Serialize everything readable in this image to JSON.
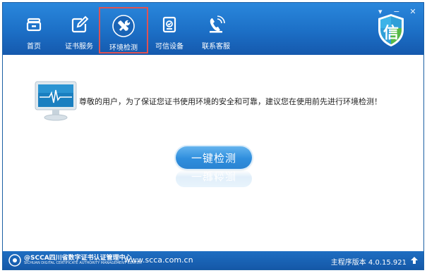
{
  "nav": {
    "items": [
      {
        "label": "首页",
        "icon": "home-icon"
      },
      {
        "label": "证书服务",
        "icon": "edit-icon"
      },
      {
        "label": "环境检测",
        "icon": "tools-icon",
        "active": true
      },
      {
        "label": "可信设备",
        "icon": "device-icon"
      },
      {
        "label": "联系客服",
        "icon": "phone-icon"
      }
    ]
  },
  "window_controls": {
    "dropdown": "▾",
    "minimize": "−",
    "close": "✕"
  },
  "logo": {
    "text": "信",
    "icon": "trust-shield-logo"
  },
  "main": {
    "message": "尊敬的用户，为了保证您证书使用环境的安全和可靠，建议您在使用前先进行环境检测！",
    "check_button": "一键检测",
    "monitor_icon": "monitor-heartbeat-icon"
  },
  "footer": {
    "org_name": "@SCCA四川省数字证书认证管理中心",
    "org_subtitle": "SICHUAN DIGITAL CERTIFICATE AUTHORITY MANAGEMENT CENTER",
    "website": "www.scca.com.cn",
    "version": "主程序版本 4.0.15.921"
  },
  "colors": {
    "header_blue": "#1c6fc6",
    "active_border": "#e05252",
    "button_blue": "#2f8edd",
    "footer_blue": "#1558a8"
  }
}
